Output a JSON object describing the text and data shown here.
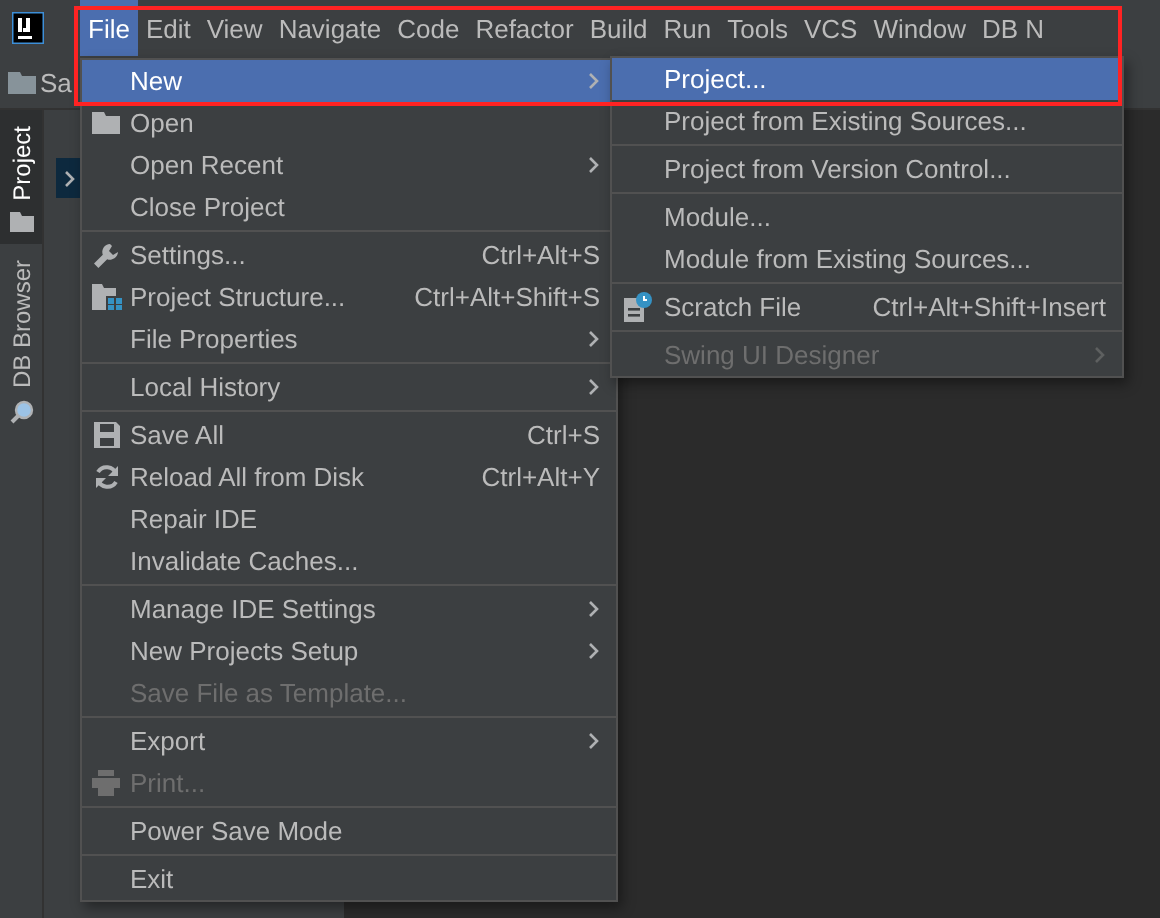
{
  "menu_bar": [
    {
      "label": "File",
      "selected": true
    },
    {
      "label": "Edit",
      "selected": false
    },
    {
      "label": "View",
      "selected": false
    },
    {
      "label": "Navigate",
      "selected": false
    },
    {
      "label": "Code",
      "selected": false
    },
    {
      "label": "Refactor",
      "selected": false
    },
    {
      "label": "Build",
      "selected": false
    },
    {
      "label": "Run",
      "selected": false
    },
    {
      "label": "Tools",
      "selected": false
    },
    {
      "label": "VCS",
      "selected": false
    },
    {
      "label": "Window",
      "selected": false
    },
    {
      "label": "DB N",
      "selected": false
    }
  ],
  "navigation_bar": {
    "text": "Sa"
  },
  "tool_windows": [
    {
      "label": "Project",
      "selected": true
    },
    {
      "label": "DB Browser",
      "selected": false
    }
  ],
  "file_menu": [
    {
      "kind": "plain",
      "label": "New",
      "submenu": true,
      "selected": true,
      "disabled": false
    },
    {
      "kind": "folder",
      "label": "Open",
      "selected": false,
      "disabled": false
    },
    {
      "kind": "plain",
      "label": "Open Recent",
      "submenu": true,
      "selected": false,
      "disabled": false
    },
    {
      "kind": "plain",
      "label": "Close Project",
      "selected": false,
      "disabled": false
    },
    {
      "kind": "separator"
    },
    {
      "kind": "wrench",
      "label": "Settings...",
      "shortcut": "Ctrl+Alt+S",
      "selected": false,
      "disabled": false
    },
    {
      "kind": "structure",
      "label": "Project Structure...",
      "shortcut": "Ctrl+Alt+Shift+S",
      "selected": false,
      "disabled": false
    },
    {
      "kind": "plain",
      "label": "File Properties",
      "submenu": true,
      "selected": false,
      "disabled": false
    },
    {
      "kind": "separator"
    },
    {
      "kind": "plain",
      "label": "Local History",
      "submenu": true,
      "selected": false,
      "disabled": false
    },
    {
      "kind": "separator"
    },
    {
      "kind": "save",
      "label": "Save All",
      "shortcut": "Ctrl+S",
      "selected": false,
      "disabled": false
    },
    {
      "kind": "reload",
      "label": "Reload All from Disk",
      "shortcut": "Ctrl+Alt+Y",
      "selected": false,
      "disabled": false
    },
    {
      "kind": "plain",
      "label": "Repair IDE",
      "selected": false,
      "disabled": false
    },
    {
      "kind": "plain",
      "label": "Invalidate Caches...",
      "selected": false,
      "disabled": false
    },
    {
      "kind": "separator"
    },
    {
      "kind": "plain",
      "label": "Manage IDE Settings",
      "submenu": true,
      "selected": false,
      "disabled": false
    },
    {
      "kind": "plain",
      "label": "New Projects Setup",
      "submenu": true,
      "selected": false,
      "disabled": false
    },
    {
      "kind": "plain",
      "label": "Save File as Template...",
      "selected": false,
      "disabled": true
    },
    {
      "kind": "separator"
    },
    {
      "kind": "plain",
      "label": "Export",
      "submenu": true,
      "selected": false,
      "disabled": false
    },
    {
      "kind": "print",
      "label": "Print...",
      "selected": false,
      "disabled": true
    },
    {
      "kind": "separator"
    },
    {
      "kind": "plain",
      "label": "Power Save Mode",
      "selected": false,
      "disabled": false
    },
    {
      "kind": "separator"
    },
    {
      "kind": "plain",
      "label": "Exit",
      "selected": false,
      "disabled": false
    }
  ],
  "new_submenu": [
    {
      "kind": "plain",
      "label": "Project...",
      "selected": true,
      "disabled": false
    },
    {
      "kind": "plain",
      "label": "Project from Existing Sources...",
      "selected": false,
      "disabled": false
    },
    {
      "kind": "separator"
    },
    {
      "kind": "plain",
      "label": "Project from Version Control...",
      "selected": false,
      "disabled": false
    },
    {
      "kind": "separator"
    },
    {
      "kind": "plain",
      "label": "Module...",
      "selected": false,
      "disabled": false
    },
    {
      "kind": "plain",
      "label": "Module from Existing Sources...",
      "selected": false,
      "disabled": false
    },
    {
      "kind": "separator"
    },
    {
      "kind": "scratch",
      "label": "Scratch File",
      "shortcut": "Ctrl+Alt+Shift+Insert",
      "selected": false,
      "disabled": false
    },
    {
      "kind": "separator"
    },
    {
      "kind": "plain",
      "label": "Swing UI Designer",
      "submenu": true,
      "selected": false,
      "disabled": true
    }
  ]
}
